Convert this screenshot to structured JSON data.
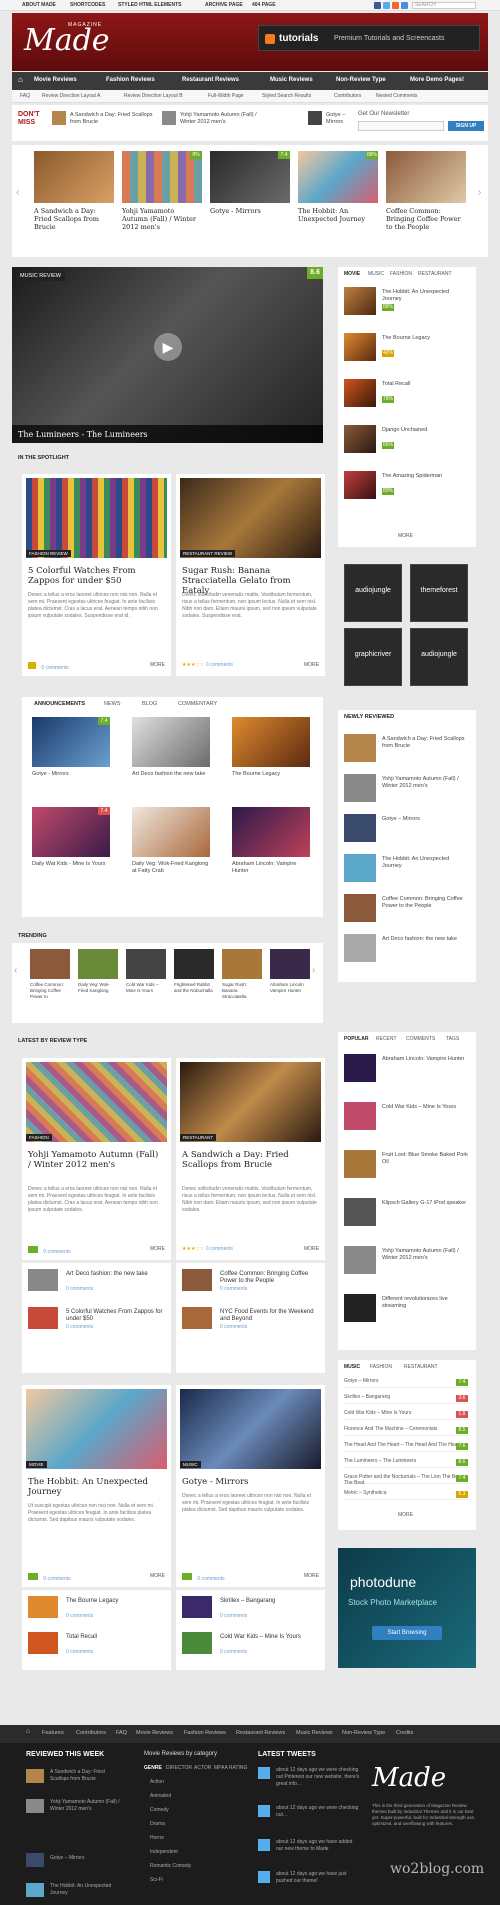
{
  "topbar": {
    "links": [
      "ABOUT MADE",
      "SHORTCODES",
      "STYLED HTML ELEMENTS",
      "ARCHIVE PAGE",
      "404 PAGE"
    ],
    "search_placeholder": "SEARCH"
  },
  "header": {
    "logo": "Made",
    "logo_sub": "MAGAZINE",
    "banner_title": "tutorials",
    "banner_sub": "Premium Tutorials and Screencasts"
  },
  "nav": {
    "items": [
      "Movie Reviews",
      "Fashion Reviews",
      "Restaurant Reviews",
      "Music Reviews",
      "Non-Review Type",
      "More Demo Pages!"
    ]
  },
  "subnav": {
    "items": [
      "FAQ",
      "Review Direction Layout A",
      "Review Direction Layout B",
      "Full-Width Page",
      "Styled Search Results",
      "Contributors",
      "Nested Comments"
    ]
  },
  "dontmiss": {
    "label": "DON'T MISS",
    "items": [
      "A Sandwich a Day: Fried Scallops from Brucie",
      "Yohji Yamamoto Autumn (Fall) / Winter 2012 men's",
      "Gotye – Mirrors"
    ],
    "newsletter_label": "Get Our Newsletter",
    "signup": "SIGN UP"
  },
  "carousel": {
    "items": [
      {
        "title": "A Sandwich a Day: Fried Scallops from Brucie",
        "score": ""
      },
      {
        "title": "Yohji Yamamoto Autumn (Fall) / Winter 2012 men's",
        "score": "8%"
      },
      {
        "title": "Gotye - Mirrors",
        "score": "7.4"
      },
      {
        "title": "The Hobbit: An Unexpected Journey",
        "score": "88%"
      },
      {
        "title": "Coffee Common: Bringing Coffee Power to the People",
        "score": ""
      }
    ]
  },
  "featured": {
    "tag": "MUSIC REVIEW",
    "score": "8.6",
    "caption": "The Lumineers - The Lumineers"
  },
  "sidetabs1": {
    "tabs": [
      "MOVIE",
      "MUSIC",
      "FASHION",
      "RESTAURANT"
    ],
    "items": [
      {
        "title": "The Hobbit: An Unexpected Journey",
        "score": "88%"
      },
      {
        "title": "The Bourne Legacy",
        "score": "42%"
      },
      {
        "title": "Total Recall",
        "score": "78%"
      },
      {
        "title": "Django Unchained",
        "score": "66%"
      },
      {
        "title": "The Amazing Spiderman",
        "score": "80%"
      }
    ],
    "more": "MORE"
  },
  "spotlight": {
    "label": "IN THE SPOTLIGHT",
    "cards": [
      {
        "tag": "FASHION REVIEW",
        "title": "5 Colorful Watches From Zappos for under $50",
        "excerpt": "Donec a tellus a eros laoreet ultrices non nisi non. Nulla et sem mi. Praesent egestas ultrices feugiat. In ante facilisis platea dictumst. Cras a lacus erat. Aenean tempo nibh non ipsum vulputate sodales. Suspendisse erat id.",
        "comments": "0 comments",
        "more": "MORE"
      },
      {
        "tag": "RESTAURANT REVIEW",
        "title": "Sugar Rush: Banana Stracciatella Gelato from Eataly",
        "excerpt": "Donec sollicitudin venenatis mattis. Vestibulum fermentum, risus a tellus fermentum, non ipsum lectus. Nulla et sem nisl. Nibh non dam. Etiam mauris ipsum, sed non ipsum vulputate sodales. Suspendisse erat.",
        "comments": "0 comments",
        "more": "MORE"
      }
    ]
  },
  "ads": [
    "audiojungle",
    "themeforest",
    "graphicriver",
    "audiojungle"
  ],
  "tabsbox": {
    "tabs": [
      "ANNOUNCEMENTS",
      "NEWS",
      "BLOG",
      "COMMENTARY"
    ],
    "items": [
      {
        "title": "Gotye - Mirrors",
        "score": "7.4"
      },
      {
        "title": "Art Deco fashion the new take",
        "score": ""
      },
      {
        "title": "The Bourne Legacy",
        "score": ""
      },
      {
        "title": "Daily Wat Kids - Mine Is Yours",
        "score": "7.4"
      },
      {
        "title": "Daily Veg: Wok-Fried Kanglong at Fatty Crab",
        "score": ""
      },
      {
        "title": "Abraham Lincoln: Vampire Hunter",
        "score": ""
      }
    ]
  },
  "newly": {
    "label": "NEWLY REVIEWED",
    "items": [
      {
        "title": "A Sandwich a Day: Fried Scallops from Brucie"
      },
      {
        "title": "Yohji Yamamoto Autumn (Fall) / Winter 2012 men's"
      },
      {
        "title": "Gotye – Mirrors"
      },
      {
        "title": "The Hobbit: An Unexpected Journey"
      },
      {
        "title": "Coffee Common: Bringing Coffee Power to the People"
      },
      {
        "title": "Art Deco fashion: the new take"
      }
    ]
  },
  "trending": {
    "label": "TRENDING",
    "items": [
      "Coffee Common: Bringing Coffee Power to",
      "Daily Veg: Wok-Fried Kanglong",
      "Cold War Kids – Mine Is Yours",
      "Frightened Rabbit and the Nobuchalla",
      "Sugar Rush: Banana Stracciatella",
      "Abraham Lincoln Vampire Hunter"
    ]
  },
  "latest": {
    "label": "LATEST BY REVIEW TYPE",
    "cards": [
      {
        "tag": "FASHION",
        "title": "Yohji Yamamoto Autumn (Fall) / Winter 2012 men's",
        "excerpt": "Donec a tellus a eros laoreet ultrices non nisi non. Nulla et sem mi. Praesent egestas ultrices feugiat. In ante facilisis platea dictumst. Cras a lacus erat. Aenean tempo nibh non ipsum vulputate sodales.",
        "comments": "0 comments",
        "more": "MORE"
      },
      {
        "tag": "RESTAURANT",
        "title": "A Sandwich a Day: Fried Scallops from Brucie",
        "excerpt": "Donec sollicitudin venenatis mattis. Vestibulum fermentum, risus a tellus fermentum, non ipsum lectus. Nulla et sem nisl. Nibh non dam. Etiam mauris ipsum, sed non ipsum vulputate sodales.",
        "comments": "0 comments",
        "more": "MORE"
      },
      {
        "tag": "MOVIE",
        "title": "The Hobbit: An Unexpected Journey",
        "excerpt": "Ut suscipit egestas ultrices non nisi non. Nulla et sem mi. Praesent egestas ultrices feugiat. In ante facilisis platea dictumst. Sed dapibus mauris vulputate sodales.",
        "comments": "0 comments",
        "more": "MORE"
      },
      {
        "tag": "MUSIC",
        "title": "Gotye - Mirrors",
        "excerpt": "Donec a tellus a eros laoreet ultrices non nisi non. Nulla et sem mi. Praesent egestas ultrices feugiat. In ante facilisis platea dictumst. Sed dapibus mauris vulputate sodales.",
        "comments": "0 comments",
        "more": "MORE"
      }
    ],
    "minis": [
      {
        "title": "Art Deco fashion: the new take",
        "meta": "0 comments"
      },
      {
        "title": "5 Colorful Watches From Zappos for under $50",
        "meta": "0 comments"
      },
      {
        "title": "Coffee Common: Bringing Coffee Power to the People",
        "meta": "0 comments"
      },
      {
        "title": "NYC Food Events for the Weekend and Beyond",
        "meta": "0 comments"
      },
      {
        "title": "The Bourne Legacy",
        "meta": "0 comments"
      },
      {
        "title": "Total Recall",
        "meta": "0 comments"
      },
      {
        "title": "Skrillex – Bangarang",
        "meta": "0 comments"
      },
      {
        "title": "Cold War Kids – Mine Is Yours",
        "meta": "0 comments"
      }
    ]
  },
  "popular": {
    "tabs": [
      "POPULAR",
      "RECENT",
      "COMMENTS",
      "TAGS"
    ],
    "items": [
      "Abraham Lincoln: Vampire Hunter",
      "Cold War Kids – Mine Is Yours",
      "Fruit Loot: Blue Smoke Baked Pork Oil",
      "Klipsch Gallery G-17 iPod speaker",
      "Yohji Yamamoto Autumn (Fall) / Winter 2012 men's",
      "Different revolutionizes live streaming"
    ]
  },
  "musiclist": {
    "tabs": [
      "MUSIC",
      "FASHION",
      "RESTAURANT"
    ],
    "items": [
      {
        "title": "Gotye – Mirrors",
        "score": "7.4"
      },
      {
        "title": "Skrillex – Bangarang",
        "score": "3.6"
      },
      {
        "title": "Cold War Kids – Mine Is Yours",
        "score": "1.8"
      },
      {
        "title": "Florence And The Machine – Ceremonials",
        "score": "8.5"
      },
      {
        "title": "The Head And The Heart – The Head And The Heart",
        "score": "7.6"
      },
      {
        "title": "The Lumineers – The Lumineers",
        "score": "8.6"
      },
      {
        "title": "Grace Potter and the Nocturnals – The Lion The Beast The Beat",
        "score": "7.4"
      },
      {
        "title": "Metric – Synthetica",
        "score": "6.3"
      }
    ],
    "more": "MORE"
  },
  "photodune": {
    "title": "photodune",
    "sub": "Stock Photo Marketplace",
    "btn": "Start Browsing"
  },
  "footer_nav": [
    "Features",
    "Contributors",
    "FAQ",
    "Movie Reviews",
    "Fashion Reviews",
    "Restaurant Reviews",
    "Music Reviews",
    "Non-Review Type",
    "Credits"
  ],
  "footer": {
    "col1_title": "REVIEWED THIS WEEK",
    "col1_items": [
      "A Sandwich a Day: Fried Scallops from Brucie",
      "Yohji Yamamoto Autumn (Fall) / Winter 2012 men's",
      "Gotye – Mirrors",
      "The Hobbit: An Unexpected Journey"
    ],
    "col2_title": "Movie Reviews by category",
    "col2_tabs": [
      "GENRE",
      "DIRECTOR",
      "ACTOR",
      "MPAA RATING"
    ],
    "col2_items": [
      "Action",
      "Animated",
      "Comedy",
      "Drama",
      "Horror",
      "Independent",
      "Romantic Comedy",
      "Sci-Fi"
    ],
    "col3_title": "LATEST TWEETS",
    "col3_items": [
      "about 12 days ago we were checking out Pinterest our new website, there's great info…",
      "about 12 days ago we were checking out…",
      "about 12 days ago we have added our new theme to Made",
      "about 12 days ago we have just pushed our theme!"
    ],
    "logo": "Made",
    "about": "This is the third generation of Magazine Review themes built by Industrial Themes and it is our best yet. Super-powerful, built for Industrial-strength use, optimized, and overflowing with features."
  },
  "watermark": "wo2blog.com"
}
